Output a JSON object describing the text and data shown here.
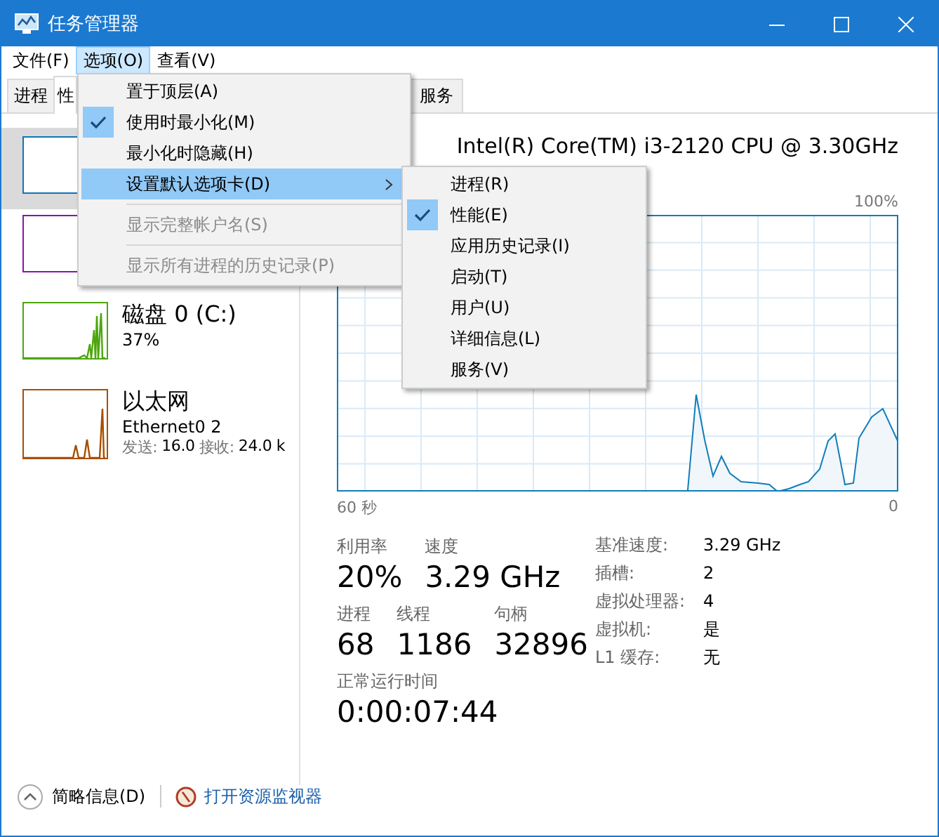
{
  "window": {
    "title": "任务管理器"
  },
  "menu_bar": [
    {
      "label": "文件(F)",
      "selected": false
    },
    {
      "label": "选项(O)",
      "selected": true
    },
    {
      "label": "查看(V)",
      "selected": false
    }
  ],
  "tabs": [
    {
      "label": "进程",
      "selected": false
    },
    {
      "label": "性",
      "selected": true
    },
    {
      "label": "服务",
      "selected": false
    }
  ],
  "sidebar": {
    "items": [
      {
        "kind": "cpu",
        "selected": true,
        "color": "#1174b8"
      },
      {
        "kind": "memory",
        "selected": false,
        "color": "#8b12ae"
      },
      {
        "kind": "disk",
        "selected": false,
        "color": "#4da60c",
        "name": "磁盘 0 (C:)",
        "detail": "37%"
      },
      {
        "kind": "network",
        "selected": false,
        "color": "#a74f01",
        "name": "以太网",
        "detail": "Ethernet0 2",
        "rates": [
          {
            "label": "发送:",
            "value": "16.0"
          },
          {
            "label": "接收:",
            "value": "24.0 k"
          }
        ]
      }
    ]
  },
  "performance": {
    "title": "Intel(R) Core(TM) i3-2120 CPU @ 3.30GHz",
    "graph": {
      "max_label": "100%",
      "time_label": "60 秒",
      "min_label": "0"
    },
    "stats": [
      [
        {
          "label": "利用率",
          "value": "20%"
        },
        {
          "label": "速度",
          "value": "3.29 GHz"
        }
      ],
      [
        {
          "label": "进程",
          "value": "68"
        },
        {
          "label": "线程",
          "value": "1186"
        },
        {
          "label": "句柄",
          "value": "32896"
        }
      ],
      [
        {
          "label": "正常运行时间",
          "value": "0:00:07:44"
        }
      ]
    ],
    "specs": [
      {
        "label": "基准速度:",
        "value": "3.29 GHz"
      },
      {
        "label": "插槽:",
        "value": "2"
      },
      {
        "label": "虚拟处理器:",
        "value": "4"
      },
      {
        "label": "虚拟机:",
        "value": "是"
      },
      {
        "label": "L1 缓存:",
        "value": "无"
      }
    ]
  },
  "options_menu": [
    {
      "label": "置于顶层(A)",
      "checked": false,
      "selected": false,
      "disabled": false,
      "has_submenu": false
    },
    {
      "label": "使用时最小化(M)",
      "checked": true,
      "selected": false,
      "disabled": false,
      "has_submenu": false
    },
    {
      "label": "最小化时隐藏(H)",
      "checked": false,
      "selected": false,
      "disabled": false,
      "has_submenu": false
    },
    {
      "label": "设置默认选项卡(D)",
      "checked": false,
      "selected": true,
      "disabled": false,
      "has_submenu": true
    },
    {
      "label": "显示完整帐户名(S)",
      "checked": false,
      "selected": false,
      "disabled": true,
      "has_submenu": false
    },
    {
      "label": "显示所有进程的历史记录(P)",
      "checked": false,
      "selected": false,
      "disabled": true,
      "has_submenu": false
    }
  ],
  "default_tab_submenu": [
    {
      "label": "进程(R)",
      "checked": false
    },
    {
      "label": "性能(E)",
      "checked": true
    },
    {
      "label": "应用历史记录(I)",
      "checked": false
    },
    {
      "label": "启动(T)",
      "checked": false
    },
    {
      "label": "用户(U)",
      "checked": false
    },
    {
      "label": "详细信息(L)",
      "checked": false
    },
    {
      "label": "服务(V)",
      "checked": false
    }
  ],
  "footer": {
    "details_label": "简略信息(D)",
    "link": "打开资源监视器"
  }
}
